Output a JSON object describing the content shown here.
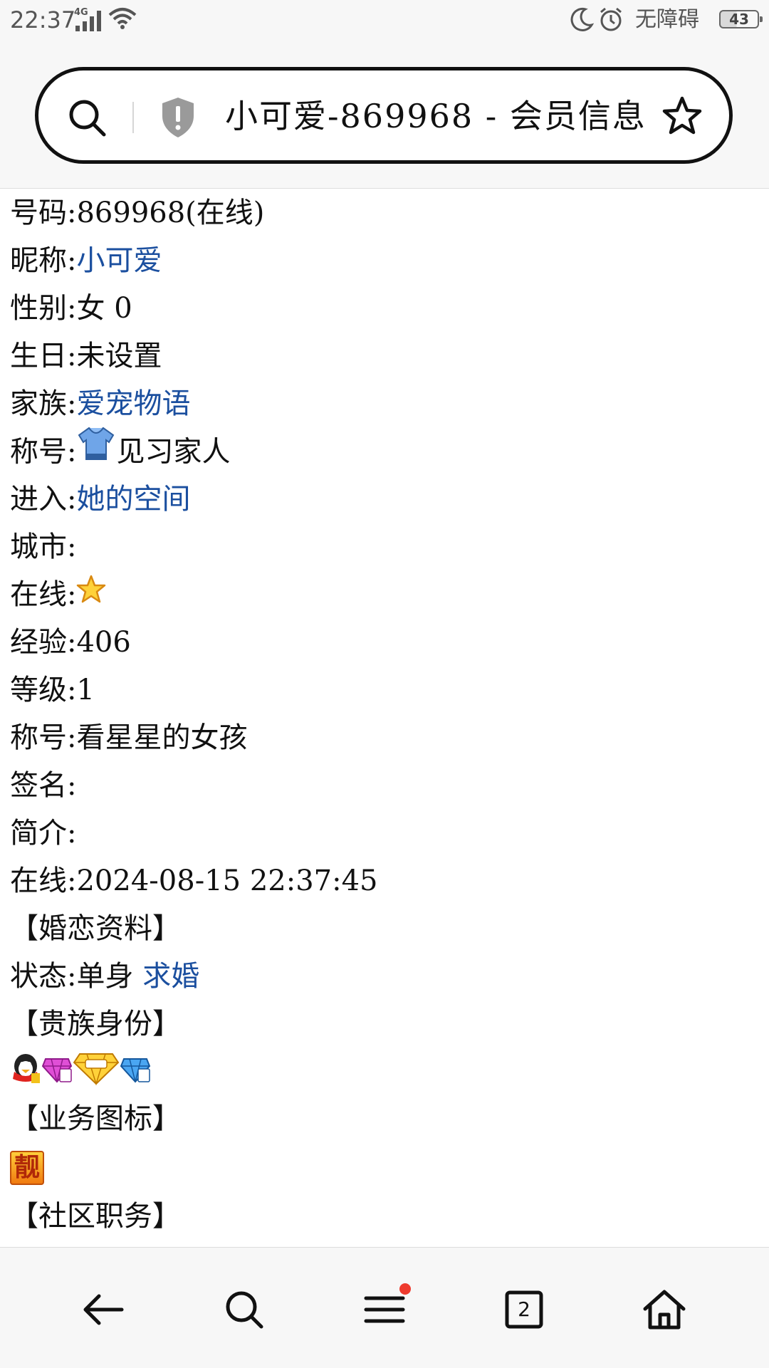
{
  "status_bar": {
    "time": "22:37",
    "network_label": "4G",
    "accessibility_text": "无障碍",
    "battery": "43"
  },
  "address_bar": {
    "title": "小可爱-869968 - 会员信息"
  },
  "profile": {
    "number_label": "号码:",
    "number_value": "869968(在线)",
    "nickname_label": "昵称:",
    "nickname_value": "小可爱",
    "gender_label": "性别:",
    "gender_value": "女 0",
    "birthday_label": "生日:",
    "birthday_value": "未设置",
    "family_label": "家族:",
    "family_value": "爱宠物语",
    "title_label": "称号:",
    "title_value": "见习家人",
    "enter_label": "进入:",
    "enter_value": "她的空间",
    "city_label": "城市:",
    "city_value": "",
    "online_label": "在线:",
    "experience_label": "经验:",
    "experience_value": "406",
    "level_label": "等级:",
    "level_value": "1",
    "title2_label": "称号:",
    "title2_value": "看星星的女孩",
    "signature_label": "签名:",
    "signature_value": "",
    "intro_label": "简介:",
    "intro_value": "",
    "last_online_label": "在线:",
    "last_online_value": "2024-08-15 22:37:45"
  },
  "marriage": {
    "section_title": "【婚恋资料】",
    "status_label": "状态:",
    "status_value": "单身",
    "propose_link": "求婚"
  },
  "noble": {
    "section_title": "【贵族身份】",
    "badges": [
      "qq-vip-badge",
      "purple-diamond-badge",
      "gold-diamond-badge",
      "blue-diamond-badge"
    ]
  },
  "business": {
    "section_title": "【业务图标】",
    "icon": "liang-badge",
    "icon_char": "靓"
  },
  "community": {
    "section_title": "【社区职务】"
  },
  "bottom_nav": {
    "tabs_count": "2"
  },
  "colors": {
    "link": "#1b4f9f",
    "notification_dot": "#ee3b2e"
  }
}
